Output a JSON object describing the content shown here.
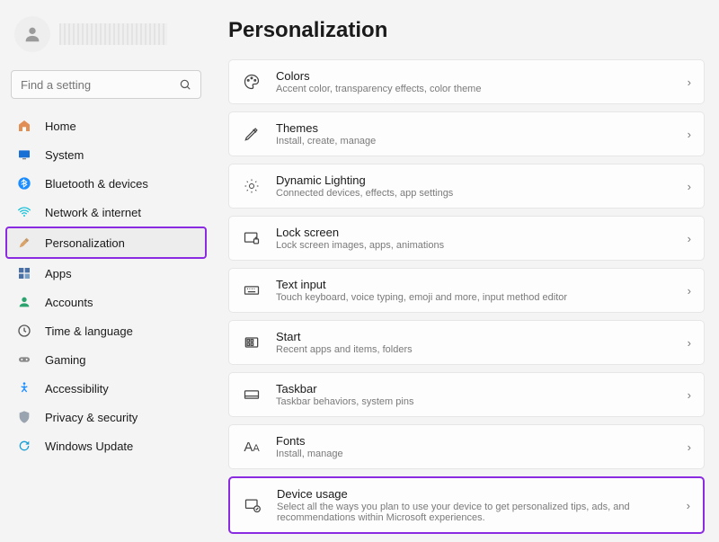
{
  "search": {
    "placeholder": "Find a setting"
  },
  "nav": [
    {
      "label": "Home"
    },
    {
      "label": "System"
    },
    {
      "label": "Bluetooth & devices"
    },
    {
      "label": "Network & internet"
    },
    {
      "label": "Personalization"
    },
    {
      "label": "Apps"
    },
    {
      "label": "Accounts"
    },
    {
      "label": "Time & language"
    },
    {
      "label": "Gaming"
    },
    {
      "label": "Accessibility"
    },
    {
      "label": "Privacy & security"
    },
    {
      "label": "Windows Update"
    }
  ],
  "page": {
    "title": "Personalization"
  },
  "cards": [
    {
      "title": "Colors",
      "desc": "Accent color, transparency effects, color theme"
    },
    {
      "title": "Themes",
      "desc": "Install, create, manage"
    },
    {
      "title": "Dynamic Lighting",
      "desc": "Connected devices, effects, app settings"
    },
    {
      "title": "Lock screen",
      "desc": "Lock screen images, apps, animations"
    },
    {
      "title": "Text input",
      "desc": "Touch keyboard, voice typing, emoji and more, input method editor"
    },
    {
      "title": "Start",
      "desc": "Recent apps and items, folders"
    },
    {
      "title": "Taskbar",
      "desc": "Taskbar behaviors, system pins"
    },
    {
      "title": "Fonts",
      "desc": "Install, manage"
    },
    {
      "title": "Device usage",
      "desc": "Select all the ways you plan to use your device to get personalized tips, ads, and recommendations within Microsoft experiences."
    }
  ]
}
